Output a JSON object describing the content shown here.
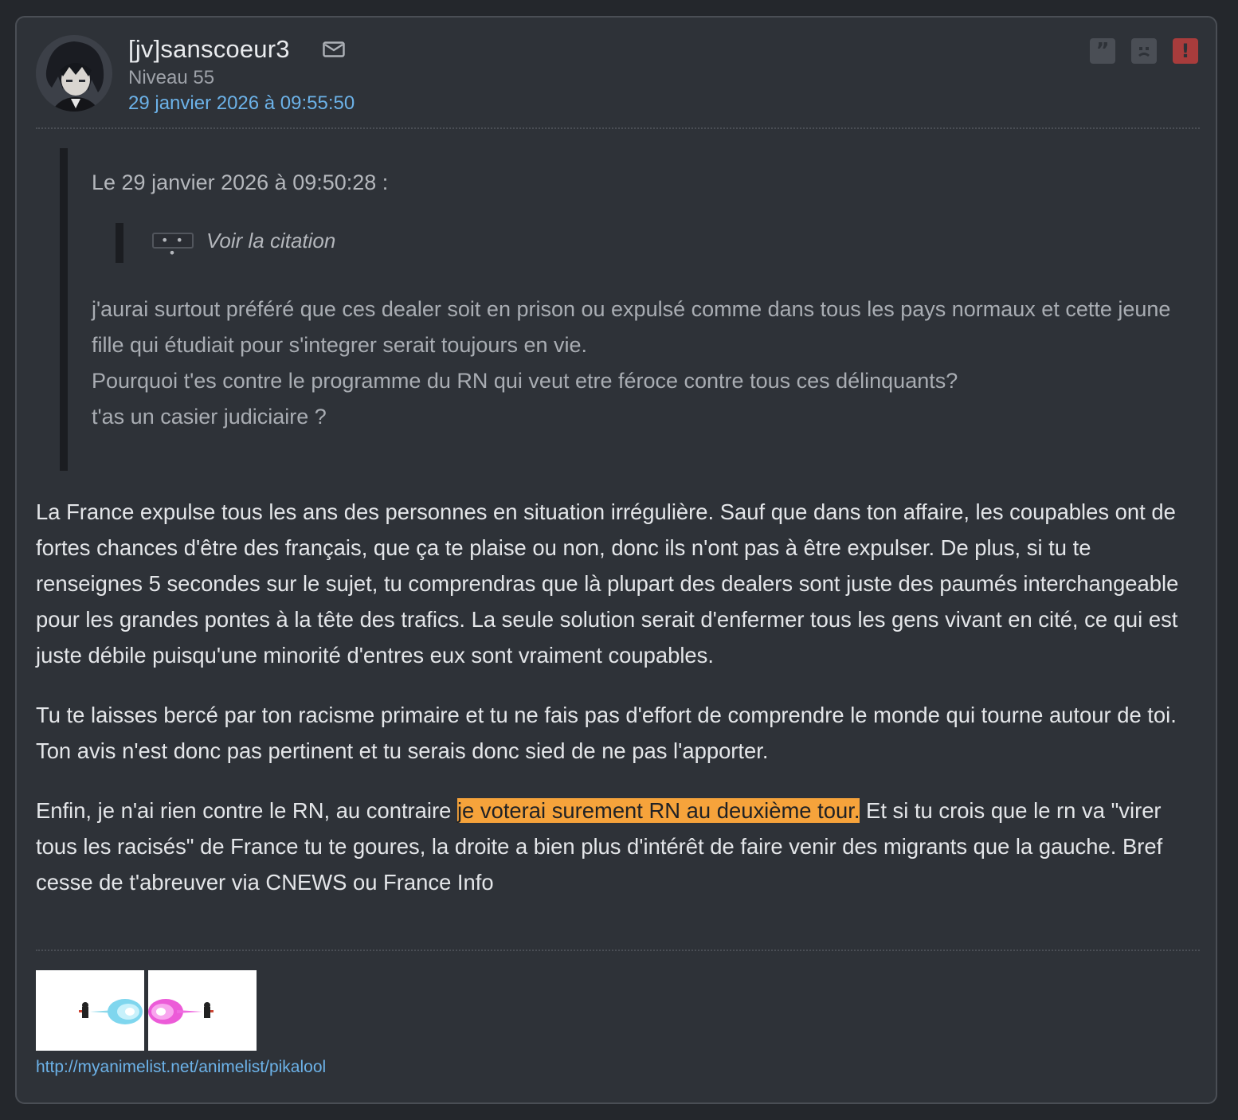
{
  "post": {
    "author": "[jv]sanscoeur3",
    "level": "Niveau 55",
    "date": "29 janvier 2026 à 09:55:50",
    "actions": {
      "quote": "quote-icon",
      "sad": "sad-face-icon",
      "report": "report-icon"
    },
    "quote": {
      "header": "Le 29 janvier 2026 à 09:50:28 :",
      "expand_label": "• • •",
      "nested_label": "Voir la citation",
      "lines": [
        "j'aurai surtout préféré que ces dealer soit en prison ou expulsé comme dans tous les pays normaux et cette jeune fille qui étudiait pour s'integrer serait toujours en vie.",
        "Pourquoi t'es contre le programme du RN qui veut etre féroce contre tous ces délinquants?",
        "t'as un casier judiciaire ?"
      ]
    },
    "body": {
      "p1": "La France expulse tous les ans des personnes en situation irrégulière. Sauf que dans ton affaire, les coupables ont de fortes chances d'être des français, que ça te plaise ou non, donc ils n'ont pas à être expulser. De plus, si tu te renseignes 5 secondes sur le sujet, tu comprendras que là plupart des dealers sont juste des paumés interchangeable pour les grandes pontes à la tête des trafics. La seule solution serait d'enfermer tous les gens vivant en cité, ce qui est juste débile puisqu'une minorité d'entres eux sont vraiment coupables.",
      "p2": "Tu te laisses bercé par ton racisme primaire et tu ne fais pas d'effort de comprendre le monde qui tourne autour de toi. Ton avis n'est donc pas pertinent et tu serais donc sied de ne pas l'apporter.",
      "p3_before": "Enfin, je n'ai rien contre le RN, au contraire ",
      "p3_highlight": "je voterai surement RN au deuxième tour.",
      "p3_after": " Et si tu crois que le rn va \"virer tous les racisés\" de France tu te goures, la droite a bien plus d'intérêt de faire venir des migrants que la gauche. Bref cesse de t'abreuver via CNEWS ou France Info"
    },
    "signature": {
      "link": "http://myanimelist.net/animelist/pikalool"
    },
    "colors": {
      "background": "#24272c",
      "card": "#2e3238",
      "link": "#6cb2e8",
      "highlight": "#f6a33b",
      "report": "#a83c3c"
    }
  }
}
